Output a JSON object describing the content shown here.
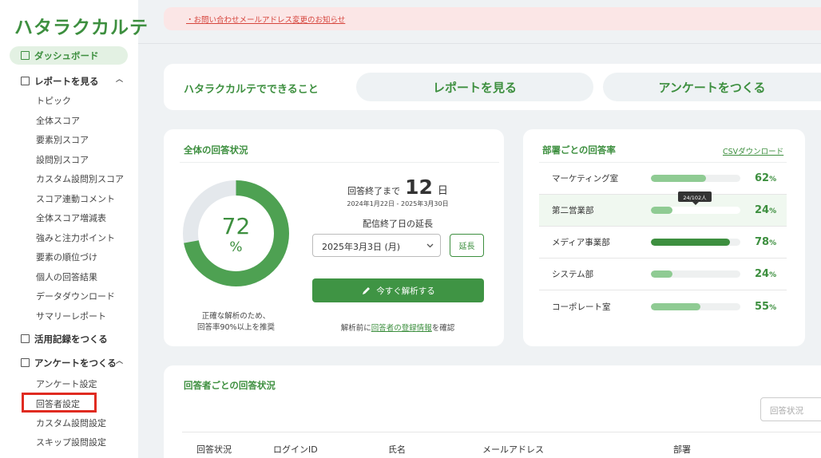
{
  "app": {
    "logo": "ハタラクカルテ"
  },
  "sidebar": {
    "dashboard": "ダッシュボード",
    "reports": {
      "label": "レポートを見る",
      "items": [
        "トピック",
        "全体スコア",
        "要素別スコア",
        "設問別スコア",
        "カスタム設問別スコア",
        "スコア連動コメント",
        "全体スコア増減表",
        "強みと注力ポイント",
        "要素の順位づけ",
        "個人の回答結果",
        "データダウンロード",
        "サマリーレポート"
      ]
    },
    "record": "活用記録をつくる",
    "survey": {
      "label": "アンケートをつくる",
      "items": [
        "アンケート設定",
        "回答者設定",
        "カスタム設問設定",
        "スキップ設問設定"
      ]
    }
  },
  "notice": {
    "text": "・お問い合わせメールアドレス変更のお知らせ"
  },
  "quicknav": {
    "title": "ハタラクカルテでできること",
    "report_button": "レポートを見る",
    "survey_button": "アンケートをつくる"
  },
  "overall": {
    "title": "全体の回答状況",
    "rate_value": "72",
    "rate_unit": "%",
    "rate_fraction": 0.72,
    "recommend_line1": "正確な解析のため、",
    "recommend_line2": "回答率90%以上を推奨",
    "deadline_prefix": "回答終了まで",
    "deadline_days": "12",
    "deadline_unit": "日",
    "period": "2024年1月22日 - 2025年3月30日",
    "extend_label": "配信終了日の延長",
    "extend_date": "2025年3月3日 (月)",
    "extend_button": "延長",
    "analyze_button": "今すぐ解析する",
    "note_prefix": "解析前に",
    "note_link": "回答者の登録情報",
    "note_suffix": "を確認"
  },
  "departments": {
    "title": "部署ごとの回答率",
    "csv_link": "CSVダウンロード",
    "tooltip": "24/102人",
    "pct_unit": "%",
    "rows": [
      {
        "name": "マーケティング室",
        "pct": "62",
        "value": 0.62
      },
      {
        "name": "第二営業部",
        "pct": "24",
        "value": 0.24
      },
      {
        "name": "メディア事業部",
        "pct": "78",
        "value": 0.88
      },
      {
        "name": "システム部",
        "pct": "24",
        "value": 0.24
      },
      {
        "name": "コーポレート室",
        "pct": "55",
        "value": 0.55
      }
    ]
  },
  "respondents": {
    "title": "回答者ごとの回答状況",
    "filter_placeholder": "回答状況",
    "columns": [
      "回答状況",
      "ログインID",
      "氏名",
      "メールアドレス",
      "部署"
    ]
  },
  "colors": {
    "accent": "#3d8f3f",
    "light": "#8fcb93",
    "alert": "#e02b20"
  }
}
